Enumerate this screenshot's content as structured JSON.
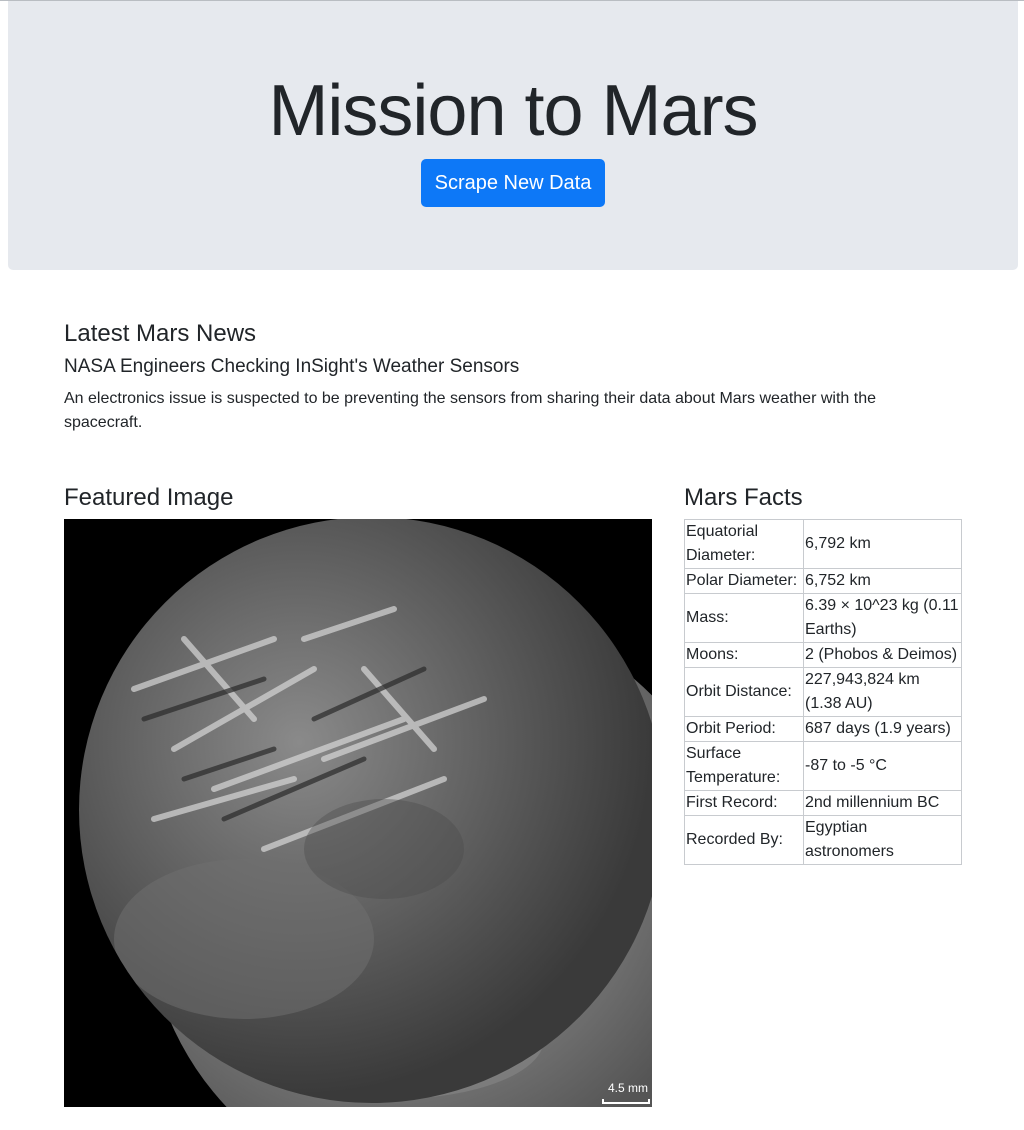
{
  "header": {
    "title": "Mission to Mars",
    "scrape_label": "Scrape New Data"
  },
  "news": {
    "heading": "Latest Mars News",
    "title": "NASA Engineers Checking InSight's Weather Sensors",
    "paragraph": "An electronics issue is suspected to be preventing the sensors from sharing their data about Mars weather with the spacecraft."
  },
  "featured": {
    "heading": "Featured Image",
    "scale_label": "4.5 mm"
  },
  "facts": {
    "heading": "Mars Facts",
    "rows": [
      {
        "label": "Equatorial Diameter:",
        "value": "6,792 km"
      },
      {
        "label": "Polar Diameter:",
        "value": "6,752 km"
      },
      {
        "label": "Mass:",
        "value": "6.39 × 10^23 kg (0.11 Earths)"
      },
      {
        "label": "Moons:",
        "value": "2 (Phobos & Deimos)"
      },
      {
        "label": "Orbit Distance:",
        "value": "227,943,824 km (1.38 AU)"
      },
      {
        "label": "Orbit Period:",
        "value": "687 days (1.9 years)"
      },
      {
        "label": "Surface Temperature:",
        "value": "-87 to -5 °C"
      },
      {
        "label": "First Record:",
        "value": "2nd millennium BC"
      },
      {
        "label": "Recorded By:",
        "value": "Egyptian astronomers"
      }
    ]
  },
  "colors": {
    "jumbotron_bg": "#e6e9ee",
    "button_primary": "#0d78f7",
    "text": "#212529"
  }
}
